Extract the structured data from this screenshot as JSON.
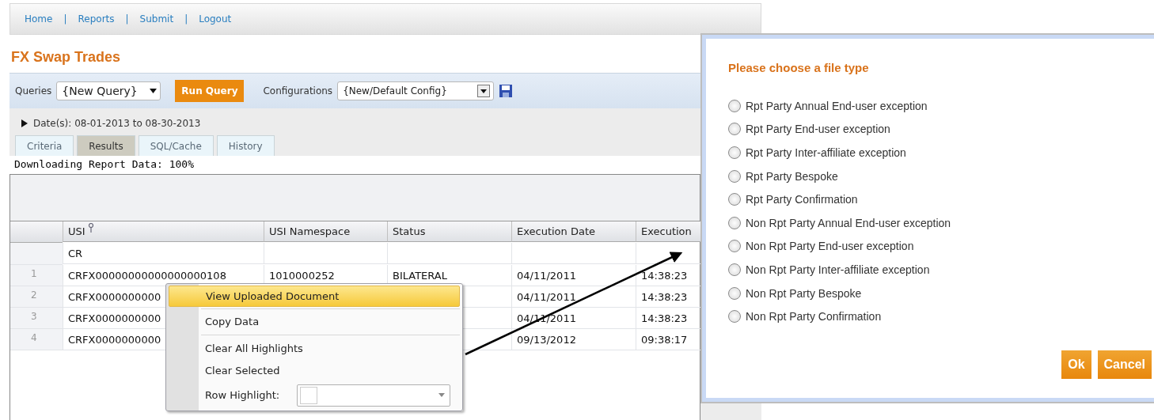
{
  "nav": [
    {
      "label": "Home",
      "separator": "|"
    },
    {
      "label": "Reports",
      "separator": "|"
    },
    {
      "label": "Submit",
      "separator": "|"
    },
    {
      "label": "Logout"
    }
  ],
  "page_title": "FX Swap Trades",
  "toolbar": {
    "queries_label": "Queries",
    "query_value": "{New Query}",
    "run_button": "Run Query",
    "config_label": "Configurations",
    "config_value": "{New/Default Config}"
  },
  "date_range": {
    "expanded": false,
    "text": "Date(s): 08-01-2013 to 08-30-2013"
  },
  "tabs": [
    {
      "label": "Criteria",
      "selected": false
    },
    {
      "label": "Results",
      "selected": true
    },
    {
      "label": "SQL/Cache",
      "selected": false
    },
    {
      "label": "History",
      "selected": false
    }
  ],
  "status_text": "Downloading Report Data: 100%",
  "table": {
    "columns": [
      "USI",
      "USI Namespace",
      "Status",
      "Execution Date",
      "Execution"
    ],
    "filter_row": [
      "CR"
    ],
    "rows": [
      {
        "number": "1",
        "cells": [
          "CRFX00000000000000000108",
          "1010000252",
          "BILATERAL",
          "04/11/2011",
          "14:38:23"
        ]
      },
      {
        "number": "2",
        "cells": [
          "CRFX0000000000",
          null,
          null,
          "04/11/2011",
          "14:38:23"
        ]
      },
      {
        "number": "3",
        "cells": [
          "CRFX0000000000",
          null,
          null,
          "04/11/2011",
          "14:38:23"
        ]
      },
      {
        "number": "4",
        "cells": [
          "CRFX0000000000",
          null,
          null,
          "09/13/2012",
          "09:38:17"
        ]
      }
    ]
  },
  "context_menu": [
    {
      "kind": "item",
      "label": "View Uploaded Document",
      "selected": true
    },
    {
      "kind": "separator"
    },
    {
      "kind": "item",
      "label": "Copy Data",
      "selected": false
    },
    {
      "kind": "separator"
    },
    {
      "kind": "item",
      "label": "Clear All Highlights",
      "selected": false
    },
    {
      "kind": "item",
      "label": "Clear Selected",
      "selected": false
    },
    {
      "kind": "picker",
      "label": "Row Highlight:",
      "selected": false
    }
  ],
  "dialog": {
    "title": "Please choose a file type",
    "options": [
      {
        "label": "Rpt Party Annual End-user exception",
        "selected": false
      },
      {
        "label": "Rpt Party End-user exception",
        "selected": false
      },
      {
        "label": "Rpt Party Inter-affiliate exception",
        "selected": false
      },
      {
        "label": "Rpt Party Bespoke",
        "selected": false
      },
      {
        "label": "Rpt Party Confirmation",
        "selected": false
      },
      {
        "label": "Non Rpt Party Annual End-user exception",
        "selected": false
      },
      {
        "label": "Non Rpt Party End-user exception",
        "selected": false
      },
      {
        "label": "Non Rpt Party Inter-affiliate exception",
        "selected": false
      },
      {
        "label": "Non Rpt Party Bespoke",
        "selected": false
      },
      {
        "label": "Non Rpt Party Confirmation",
        "selected": false
      }
    ],
    "buttons": [
      "Ok",
      "Cancel"
    ]
  }
}
